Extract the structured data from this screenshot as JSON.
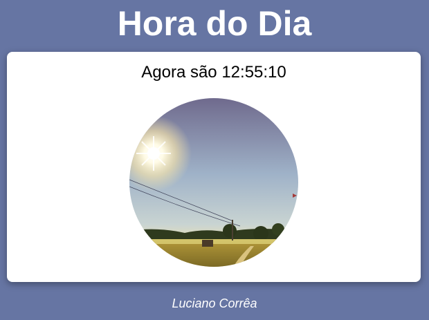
{
  "header": {
    "title": "Hora do Dia"
  },
  "main": {
    "clock_text": "Agora são 12:55:10",
    "image": {
      "subject": "sunny-morning-field-photo"
    }
  },
  "footer": {
    "author": "Luciano Corrêa"
  },
  "colors": {
    "background": "#6675a3",
    "card": "#ffffff",
    "title_text": "#ffffff",
    "clock_text": "#000000"
  }
}
